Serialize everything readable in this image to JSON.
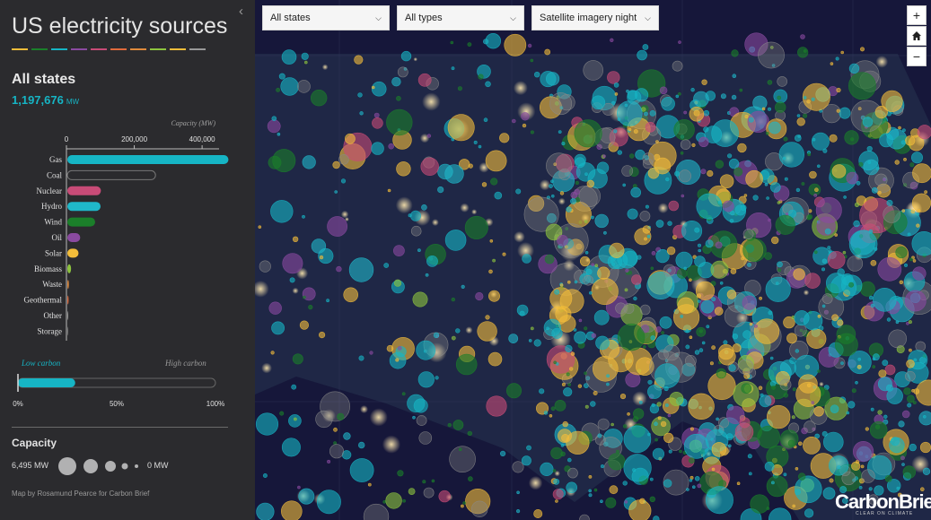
{
  "panel": {
    "title": "US electricity sources",
    "collapse_icon": "chevron-left-icon",
    "selected_region": "All states",
    "total_value": "1,197,676",
    "total_unit": "MW",
    "chart_axis_label": "Capacity (MW)",
    "low_carbon_label": "Low carbon",
    "high_carbon_label": "High carbon",
    "capacity_title": "Capacity",
    "capacity_max_label": "6,495 MW",
    "capacity_min_label": "0 MW",
    "credit": "Map by Rosamund Pearce for Carbon Brief"
  },
  "colors": {
    "gas": "#16b5c5",
    "coal": "#555555",
    "nuclear": "#c84b77",
    "hydro": "#1fb8c9",
    "wind": "#1b7f2a",
    "oil": "#8a4aa0",
    "solar": "#f3bd3a",
    "biomass": "#8dc43e",
    "waste": "#e08a3c",
    "geothermal": "#e06a3c",
    "other": "#999999",
    "storage": "#777777",
    "low_carbon": "#16b5c5"
  },
  "chart_data": [
    {
      "type": "bar",
      "orientation": "horizontal",
      "title": "",
      "xlabel": "Capacity (MW)",
      "ylabel": "",
      "xlim": [
        0,
        450000
      ],
      "xticks": [
        0,
        200000,
        400000
      ],
      "xtick_labels": [
        "0",
        "200,000",
        "400,000"
      ],
      "categories": [
        "Gas",
        "Coal",
        "Nuclear",
        "Hydro",
        "Wind",
        "Oil",
        "Solar",
        "Biomass",
        "Waste",
        "Geothermal",
        "Other",
        "Storage"
      ],
      "values": [
        475000,
        260000,
        99000,
        98000,
        82000,
        38000,
        33000,
        11000,
        4500,
        3700,
        1500,
        900
      ],
      "outlined_categories": [
        "Coal"
      ],
      "grid": false
    },
    {
      "type": "bar",
      "orientation": "horizontal",
      "title": "",
      "categories": [
        "Low carbon share"
      ],
      "values": [
        0.29
      ],
      "xlim": [
        0,
        1
      ],
      "xtick_labels": [
        "0%",
        "50%",
        "100%"
      ]
    }
  ],
  "controls": {
    "state_select": "All states",
    "type_select": "All types",
    "basemap_select": "Satellite imagery night",
    "zoom_in": "+",
    "home_icon": "home-icon",
    "zoom_out": "−"
  },
  "logo": {
    "text": "CarbonBrief",
    "tagline": "CLEAR ON CLIMATE"
  }
}
